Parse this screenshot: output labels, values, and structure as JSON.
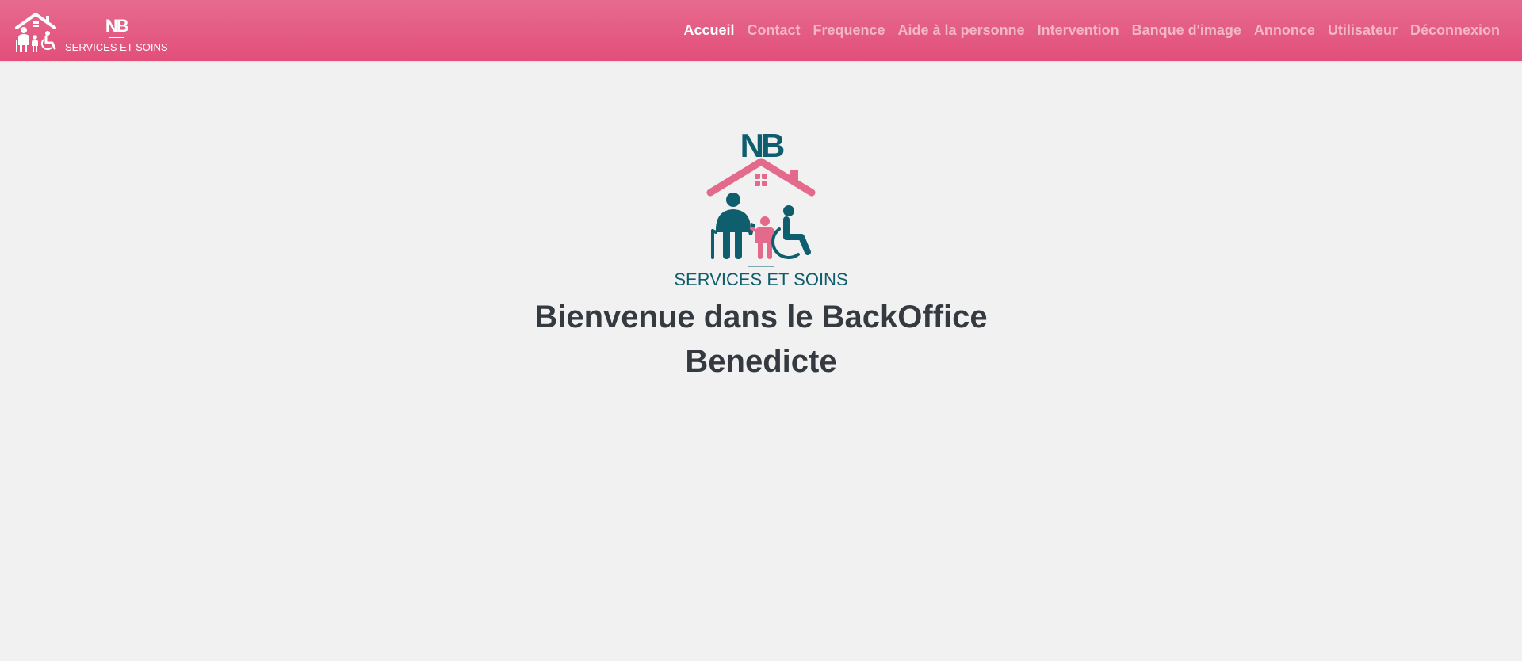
{
  "brand": {
    "monogram": "NB",
    "name": "SERVICES ET SOINS"
  },
  "nav": {
    "items": [
      {
        "label": "Accueil",
        "active": true
      },
      {
        "label": "Contact",
        "active": false
      },
      {
        "label": "Frequence",
        "active": false
      },
      {
        "label": "Aide à la personne",
        "active": false
      },
      {
        "label": "Intervention",
        "active": false
      },
      {
        "label": "Banque d'image",
        "active": false
      },
      {
        "label": "Annonce",
        "active": false
      },
      {
        "label": "Utilisateur",
        "active": false
      },
      {
        "label": "Déconnexion",
        "active": false
      }
    ]
  },
  "main": {
    "logo": {
      "monogram": "NB",
      "name": "SERVICES ET SOINS"
    },
    "welcome_title": "Bienvenue dans le BackOffice Benedicte"
  },
  "colors": {
    "navbar": "#e14f7a",
    "brand_teal": "#0f5e6e",
    "brand_pink": "#e36a8a",
    "page_background": "#f1f1f1",
    "heading_text": "#343a40"
  }
}
